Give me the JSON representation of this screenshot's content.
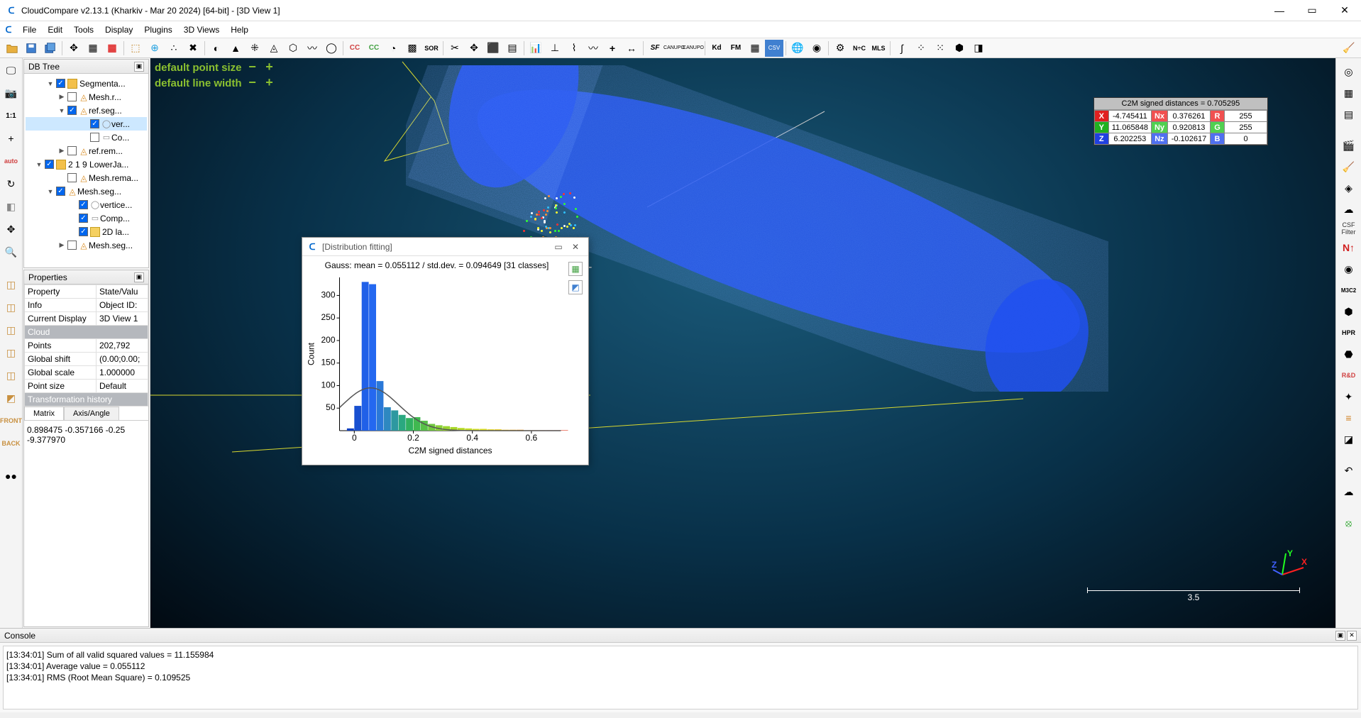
{
  "window": {
    "title": "CloudCompare v2.13.1 (Kharkiv - Mar 20 2024) [64-bit] - [3D View 1]"
  },
  "menu": [
    "File",
    "Edit",
    "Tools",
    "Display",
    "Plugins",
    "3D Views",
    "Help"
  ],
  "panels": {
    "dbtree_title": "DB Tree",
    "props_title": "Properties",
    "console_title": "Console"
  },
  "tree": {
    "items": [
      {
        "indent": 30,
        "tri": "▼",
        "chk": true,
        "icon": "folder",
        "label": "Segmenta..."
      },
      {
        "indent": 46,
        "tri": "▶",
        "chk": false,
        "icon": "mesh",
        "label": "Mesh.r..."
      },
      {
        "indent": 46,
        "tri": "▼",
        "chk": true,
        "icon": "mesh",
        "label": "ref.seg..."
      },
      {
        "indent": 78,
        "tri": "",
        "chk": true,
        "icon": "cloud",
        "label": "ver...",
        "selected": true
      },
      {
        "indent": 78,
        "tri": "",
        "chk": false,
        "icon": "doc",
        "label": "Co..."
      },
      {
        "indent": 46,
        "tri": "▶",
        "chk": false,
        "icon": "mesh",
        "label": "ref.rem..."
      },
      {
        "indent": 14,
        "tri": "▼",
        "chk": true,
        "icon": "folder",
        "label": "2 1 9 LowerJa..."
      },
      {
        "indent": 46,
        "tri": "",
        "chk": false,
        "icon": "mesh",
        "label": "Mesh.rema..."
      },
      {
        "indent": 30,
        "tri": "▼",
        "chk": true,
        "icon": "mesh",
        "label": "Mesh.seg..."
      },
      {
        "indent": 62,
        "tri": "",
        "chk": true,
        "icon": "cloud",
        "label": "vertice..."
      },
      {
        "indent": 62,
        "tri": "",
        "chk": true,
        "icon": "doc",
        "label": "Comp..."
      },
      {
        "indent": 62,
        "tri": "",
        "chk": true,
        "icon": "label",
        "label": "2D la..."
      },
      {
        "indent": 46,
        "tri": "▶",
        "chk": false,
        "icon": "mesh",
        "label": "Mesh.seg..."
      }
    ]
  },
  "properties": {
    "headers": [
      "Property",
      "State/Valu"
    ],
    "rows": [
      [
        "Info",
        "Object ID:"
      ],
      [
        "Current Display",
        "3D View 1"
      ]
    ],
    "section_cloud": "Cloud",
    "cloud_rows": [
      [
        "Points",
        "202,792"
      ],
      [
        "Global shift",
        "(0.00;0.00;"
      ],
      [
        "Global scale",
        "1.000000"
      ],
      [
        "Point size",
        "Default"
      ]
    ],
    "section_transform": "Transformation history",
    "tabs": [
      "Matrix",
      "Axis/Angle"
    ],
    "matrix_text1": "0.898475 -0.357166 -0.25",
    "matrix_text2": "-9.377970"
  },
  "hud": {
    "point_size": "default point size",
    "line_width": "default line width"
  },
  "pick": {
    "title": "C2M signed distances = 0.705295",
    "X": "-4.745411",
    "Nx": "0.376261",
    "R": "255",
    "Y": "11.065848",
    "Ny": "0.920813",
    "G": "255",
    "Z": "6.202253",
    "Nz": "-0.102617",
    "B": "0"
  },
  "scalebar": "3.5",
  "axes": {
    "x": "X",
    "y": "Y",
    "z": "Z"
  },
  "dist_dialog": {
    "title": "[Distribution fitting]",
    "chart_title": "Gauss: mean = 0.055112 / std.dev. = 0.094649 [31 classes]"
  },
  "chart_data": {
    "type": "bar",
    "title": "Gauss: mean = 0.055112 / std.dev. = 0.094649 [31 classes]",
    "xlabel": "C2M signed distances",
    "ylabel": "Count",
    "xlim": [
      -0.05,
      0.7
    ],
    "ylim": [
      0,
      340
    ],
    "xticks": [
      0,
      0.2,
      0.4,
      0.6
    ],
    "yticks": [
      50,
      100,
      150,
      200,
      250,
      300
    ],
    "bin_start": -0.025,
    "bin_width": 0.025,
    "values": [
      5,
      55,
      330,
      325,
      110,
      52,
      45,
      35,
      28,
      30,
      22,
      15,
      12,
      10,
      8,
      6,
      5,
      4,
      4,
      3,
      3,
      2,
      2,
      2,
      1,
      1,
      1,
      1,
      1,
      1,
      1
    ],
    "colors": [
      "#1040c0",
      "#1850d0",
      "#2060e8",
      "#2468f0",
      "#2a78d8",
      "#2e88c0",
      "#2e98a0",
      "#2aa880",
      "#30b060",
      "#40b850",
      "#58c048",
      "#70c840",
      "#88d038",
      "#98d430",
      "#a8d828",
      "#b8dc28",
      "#c6e028",
      "#d2e028",
      "#dde028",
      "#e6d828",
      "#ecd028",
      "#f0c028",
      "#f2b028",
      "#f4a028",
      "#f49028",
      "#f48028",
      "#f07028",
      "#ec6028",
      "#e85028",
      "#e04028",
      "#d83020"
    ],
    "gauss_curve": {
      "mean": 0.055112,
      "std": 0.094649,
      "peak_count": 95
    }
  },
  "console": {
    "lines": [
      "[13:34:01] Sum of all valid squared values = 11.155984",
      "[13:34:01] Average value = 0.055112",
      "[13:34:01] RMS (Root Mean Square) = 0.109525"
    ]
  },
  "right_strip_label": "CSF Filter"
}
